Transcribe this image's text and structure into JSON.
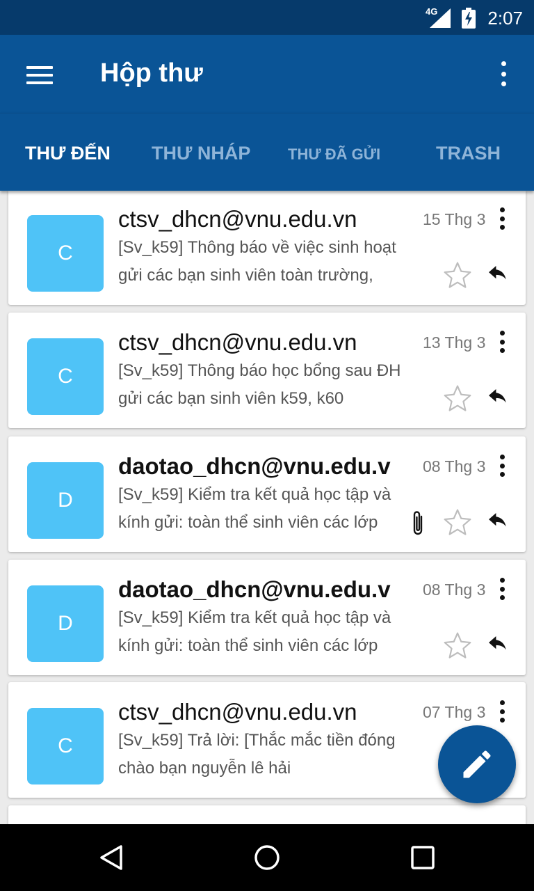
{
  "status_bar": {
    "network": "4G",
    "time": "2:07"
  },
  "app_bar": {
    "title": "Hộp thư",
    "menu_icon": "hamburger-menu-icon",
    "more_icon": "more-vert-icon"
  },
  "tabs": [
    {
      "label": "THƯ ĐẾN",
      "active": true
    },
    {
      "label": "THƯ NHÁP",
      "active": false
    },
    {
      "label": "THƯ ĐÃ GỬI",
      "active": false
    },
    {
      "label": "TRASH",
      "active": false
    }
  ],
  "emails": [
    {
      "avatar": "C",
      "sender": "ctsv_dhcn@vnu.edu.vn",
      "unread": false,
      "date": "15 Thg 3",
      "subject": "[Sv_k59] Thông báo về việc sinh hoạt",
      "preview": "gửi các bạn sinh viên toàn trường,",
      "attachment": false
    },
    {
      "avatar": "C",
      "sender": "ctsv_dhcn@vnu.edu.vn",
      "unread": false,
      "date": "13 Thg 3",
      "subject": "[Sv_k59] Thông báo học bổng sau ĐH",
      "preview": "gửi các bạn sinh viên k59, k60",
      "attachment": false
    },
    {
      "avatar": "D",
      "sender": "daotao_dhcn@vnu.edu.v",
      "unread": true,
      "date": "08 Thg 3",
      "subject": "[Sv_k59]  Kiểm tra kết quả học tập và",
      "preview": "kính gửi: toàn thể sinh viên các lớp",
      "attachment": true
    },
    {
      "avatar": "D",
      "sender": "daotao_dhcn@vnu.edu.v",
      "unread": true,
      "date": "08 Thg 3",
      "subject": "[Sv_k59]  Kiểm tra kết quả học tập và",
      "preview": "kính gửi: toàn thể sinh viên các lớp",
      "attachment": false
    },
    {
      "avatar": "C",
      "sender": "ctsv_dhcn@vnu.edu.vn",
      "unread": false,
      "date": "07 Thg 3",
      "subject": "[Sv_k59] Trả lời: [Thắc mắc tiền đóng",
      "preview": "chào bạn nguyễn lê hải",
      "attachment": false
    }
  ],
  "colors": {
    "status_bar": "#063a6b",
    "primary": "#0a5496",
    "avatar": "#4fc3f7",
    "tab_inactive": "#8eb4d8"
  },
  "fab": {
    "icon": "edit-pencil-icon"
  },
  "nav_bar": {
    "back": "back-triangle-icon",
    "home": "home-circle-icon",
    "recents": "recents-square-icon"
  }
}
